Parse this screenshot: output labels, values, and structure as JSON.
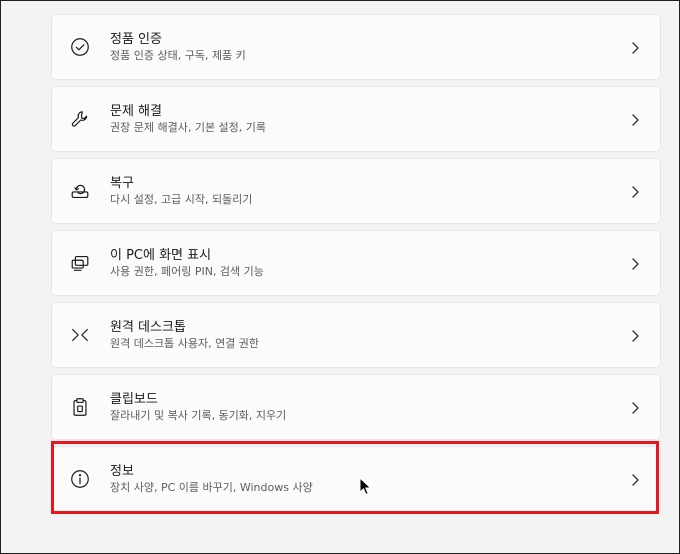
{
  "items": [
    {
      "title": "정품 인증",
      "subtitle": "정품 인증 상태, 구독, 제품 키",
      "icon": "check-circle-icon"
    },
    {
      "title": "문제 해결",
      "subtitle": "권장 문제 해결사, 기본 설정, 기록",
      "icon": "wrench-icon"
    },
    {
      "title": "복구",
      "subtitle": "다시 설정, 고급 시작, 되돌리기",
      "icon": "recovery-icon"
    },
    {
      "title": "이 PC에 화면 표시",
      "subtitle": "사용 권한, 페어링 PIN, 검색 기능",
      "icon": "project-screen-icon"
    },
    {
      "title": "원격 데스크톱",
      "subtitle": "원격 데스크톱 사용자, 연결 권한",
      "icon": "remote-desktop-icon"
    },
    {
      "title": "클립보드",
      "subtitle": "잘라내기 및 복사 기록, 동기화, 지우기",
      "icon": "clipboard-icon"
    },
    {
      "title": "정보",
      "subtitle": "장치 사양, PC 이름 바꾸기, Windows 사양",
      "icon": "info-circle-icon"
    }
  ],
  "colors": {
    "background": "#f3f3f3",
    "card": "#fbfbfb",
    "highlight_border": "#e8141e"
  }
}
